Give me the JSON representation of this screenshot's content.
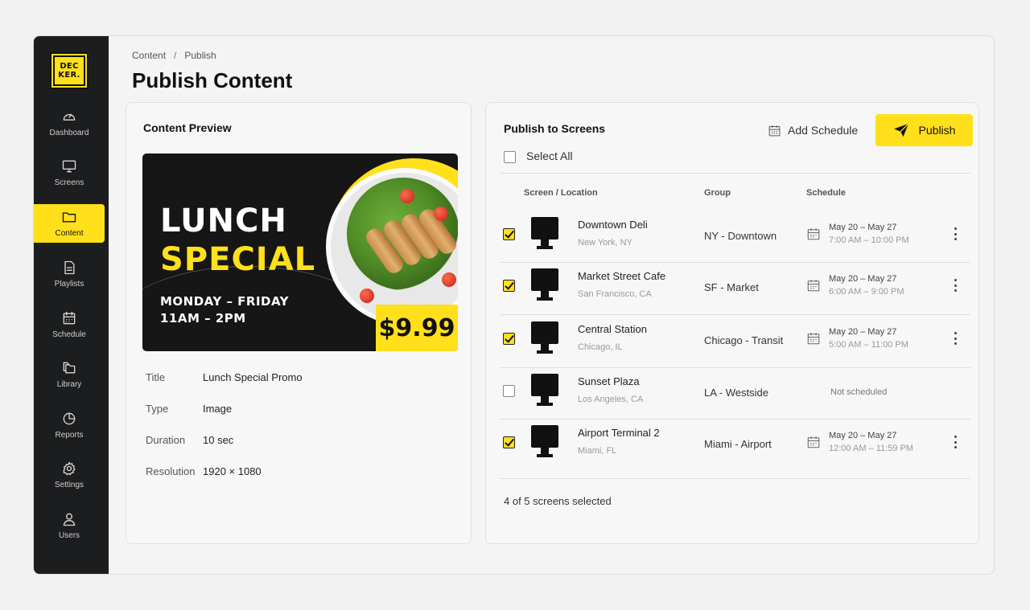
{
  "brand": {
    "logo_line1": "DEC",
    "logo_line2": "KER.",
    "accent": "#ffe01b",
    "sidebar_bg": "#1c1d1f"
  },
  "sidebar": {
    "items": [
      {
        "label": "Dashboard",
        "icon": "gauge-icon",
        "active": false
      },
      {
        "label": "Screens",
        "icon": "monitor-icon",
        "active": false
      },
      {
        "label": "Content",
        "icon": "folder-icon",
        "active": true
      },
      {
        "label": "Playlists",
        "icon": "document-icon",
        "active": false
      },
      {
        "label": "Schedule",
        "icon": "calendar-icon",
        "active": false
      },
      {
        "label": "Library",
        "icon": "library-icon",
        "active": false
      },
      {
        "label": "Reports",
        "icon": "pie-chart-icon",
        "active": false
      },
      {
        "label": "Settings",
        "icon": "gear-icon",
        "active": false
      },
      {
        "label": "Users",
        "icon": "user-icon",
        "active": false
      }
    ]
  },
  "breadcrumb": {
    "root": "Content",
    "separator": "/",
    "current": "Publish"
  },
  "page_title": "Publish Content",
  "preview_card": {
    "title": "Content Preview",
    "image": {
      "headline1": "LUNCH",
      "headline2": "SPECIAL",
      "days": "MONDAY – FRIDAY",
      "hours": "11AM – 2PM",
      "price": "$9.99"
    },
    "meta": [
      {
        "key": "Title",
        "value": "Lunch Special Promo"
      },
      {
        "key": "Type",
        "value": "Image"
      },
      {
        "key": "Duration",
        "value": "10 sec"
      },
      {
        "key": "Resolution",
        "value": "1920 × 1080"
      }
    ]
  },
  "publish_card": {
    "title": "Publish to Screens",
    "add_schedule_label": "Add Schedule",
    "publish_label": "Publish",
    "select_all_label": "Select All",
    "select_all_checked": false,
    "columns": [
      "Screen / Location",
      "Group",
      "Schedule"
    ],
    "rows": [
      {
        "checked": true,
        "name": "Downtown Deli",
        "location": "New York, NY",
        "group": "NY - Downtown",
        "date": "May 20 – May 27",
        "time": "7:00 AM – 10:00 PM"
      },
      {
        "checked": true,
        "name": "Market Street Cafe",
        "location": "San Francisco, CA",
        "group": "SF - Market",
        "date": "May 20 – May 27",
        "time": "6:00 AM – 9:00 PM"
      },
      {
        "checked": true,
        "name": "Central Station",
        "location": "Chicago, IL",
        "group": "Chicago - Transit",
        "date": "May 20 – May 27",
        "time": "5:00 AM – 11:00 PM"
      },
      {
        "checked": false,
        "name": "Sunset Plaza",
        "location": "Los Angeles, CA",
        "group": "LA - Westside",
        "date": "",
        "time": "",
        "schedule_text": "Not scheduled"
      },
      {
        "checked": true,
        "name": "Airport Terminal 2",
        "location": "Miami, FL",
        "group": "Miami - Airport",
        "date": "May 20 – May 27",
        "time": "12:00 AM – 11:59 PM"
      }
    ],
    "footer": "4 of 5 screens selected"
  }
}
